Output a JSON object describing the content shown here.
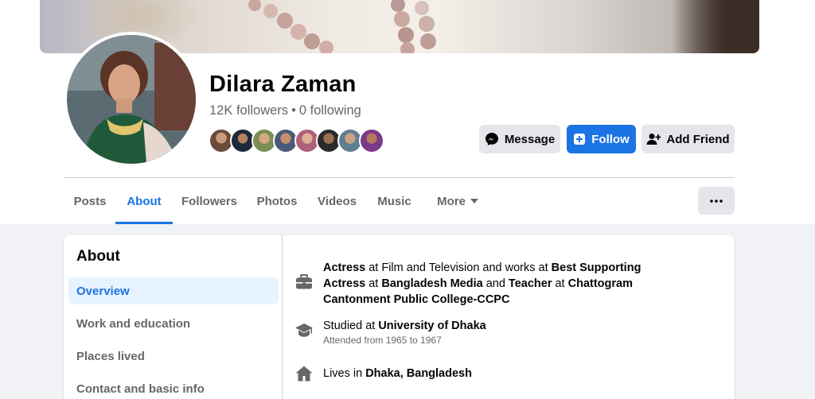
{
  "profile": {
    "name": "Dilara Zaman",
    "followers_count": "12K followers",
    "separator": "•",
    "following_count": "0 following"
  },
  "actions": {
    "message_label": "Message",
    "follow_label": "Follow",
    "add_friend_label": "Add Friend"
  },
  "tabs": [
    {
      "label": "Posts"
    },
    {
      "label": "About"
    },
    {
      "label": "Followers"
    },
    {
      "label": "Photos"
    },
    {
      "label": "Videos"
    },
    {
      "label": "Music"
    },
    {
      "label": "More"
    }
  ],
  "about": {
    "title": "About",
    "sections": [
      {
        "label": "Overview"
      },
      {
        "label": "Work and education"
      },
      {
        "label": "Places lived"
      },
      {
        "label": "Contact and basic info"
      }
    ]
  },
  "overview": {
    "work": {
      "role1": "Actress",
      "at1": " at Film and Television and works at ",
      "role2": "Best Supporting Actress",
      "at2": " at ",
      "org2": "Bangladesh Media",
      "and": " and ",
      "role3": "Teacher",
      "at3": " at ",
      "org3": "Chattogram Cantonment Public College-CCPC"
    },
    "education": {
      "prefix": "Studied at ",
      "school": "University of Dhaka",
      "dates": "Attended from 1965 to 1967"
    },
    "place": {
      "prefix": "Lives in ",
      "city": "Dhaka, Bangladesh"
    }
  },
  "colors": {
    "accent": "#1b74e4",
    "secondary_text": "#65676b",
    "button_gray": "#e4e6eb",
    "page_bg": "#f0f2f5",
    "selected_bg": "#e7f3ff"
  }
}
